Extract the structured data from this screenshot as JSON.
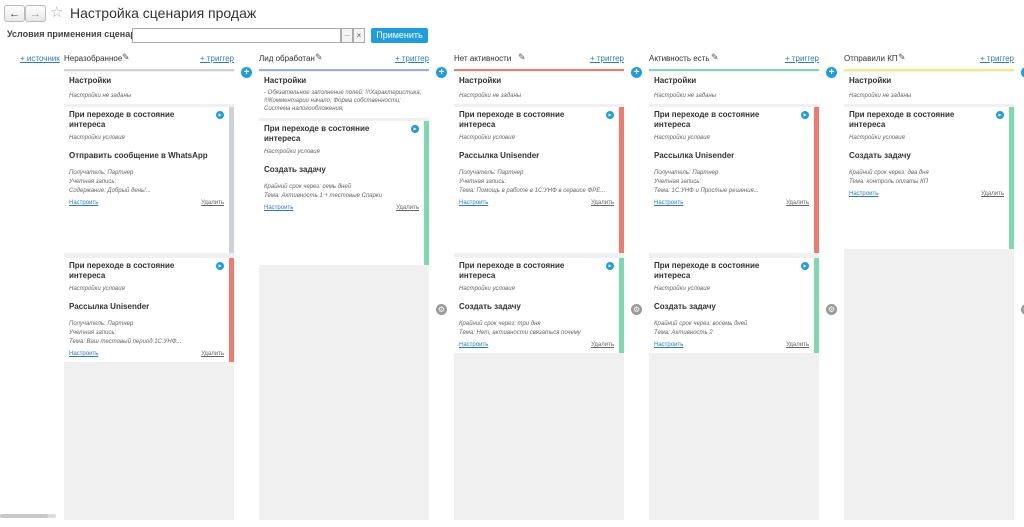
{
  "title": "Настройка сценария продаж",
  "toolbar": {
    "back": "←",
    "forward": "→",
    "star": "☆"
  },
  "conditions": {
    "label": "Условия применения сценария:",
    "value": "",
    "dots": "...",
    "clear": "×",
    "apply": "Применить"
  },
  "sources_link": "+ источник",
  "trigger_link": "+ триггер",
  "pencil": "✎",
  "plus": "+",
  "gear": "⚙",
  "play": "▶",
  "settings_title": "Настройки",
  "configure": "Настроить",
  "delete": "Удалить",
  "colors": {
    "accent": "#1e9de0",
    "gray": "#cfd2d6",
    "blue": "#98aee8",
    "red": "#ef7a6e",
    "green": "#7fd9b0",
    "yellow": "#f5ea74"
  },
  "columns": [
    {
      "name": "Неразобранное",
      "settings_sub": "Настройки не заданы",
      "cards": [
        {
          "trigger": "При переходе в состояние интереса",
          "cond": "Настройки условия",
          "action": "Отправить сообщение в WhatsApp",
          "details": [
            "Получатель: Партнер",
            "Учетная запись:",
            "Содержание: Добрый день!..."
          ]
        },
        {
          "trigger": "При переходе в состояние интереса",
          "cond": "Настройки условия",
          "action": "Рассылка Unisender",
          "details": [
            "Получатель: Партнер",
            "Учетная запись:",
            "Тема: Ваш тестовый период 1С:УНФ..."
          ]
        }
      ]
    },
    {
      "name": "Лид обработан",
      "settings_sub": "- Обязательное заполнение полей: !!!Характеристика; !!!Комментарии начало; Форма собственности; Система налогообложения;",
      "cards": [
        {
          "trigger": "При переходе в состояние интереса",
          "cond": "Настройки условия",
          "action": "Создать задачу",
          "details": [
            "Крайний срок через: семь дней",
            "Тема: Активность 1 + тестовые Спарки"
          ]
        }
      ]
    },
    {
      "name": "Нет активности",
      "settings_sub": "Настройки не заданы",
      "cards": [
        {
          "trigger": "При переходе в состояние интереса",
          "cond": "Настройки условия",
          "action": "Рассылка Unisender",
          "details": [
            "Получатель: Партнер",
            "Учетная запись:",
            "Тема: Помощь в работе в 1С:УНФ в сервисе ФРЕ..."
          ]
        },
        {
          "trigger": "При переходе в состояние интереса",
          "cond": "Настройки условия",
          "action": "Создать задачу",
          "details": [
            "Крайний срок через: три дня",
            "Тема: Нет, активности связаться почему"
          ]
        }
      ]
    },
    {
      "name": "Активность есть",
      "settings_sub": "Настройки не заданы",
      "cards": [
        {
          "trigger": "При переходе в состояние интереса",
          "cond": "Настройки условия",
          "action": "Рассылка Unisender",
          "details": [
            "Получатель: Партнер",
            "Учетная запись:",
            "Тема: 1С:УНФ и Простые решения..."
          ]
        },
        {
          "trigger": "При переходе в состояние интереса",
          "cond": "Настройки условия",
          "action": "Создать задачу",
          "details": [
            "Крайний срок через: восемь дней",
            "Тема: Активность 2"
          ]
        }
      ]
    },
    {
      "name": "Отправили КП",
      "settings_sub": "Настройки не заданы",
      "cards": [
        {
          "trigger": "При переходе в состояние интереса",
          "cond": "Настройки условия",
          "action": "Создать задачу",
          "details": [
            "Крайний срок через: два дня",
            "Тема: контроль оплаты КП"
          ]
        }
      ]
    }
  ]
}
